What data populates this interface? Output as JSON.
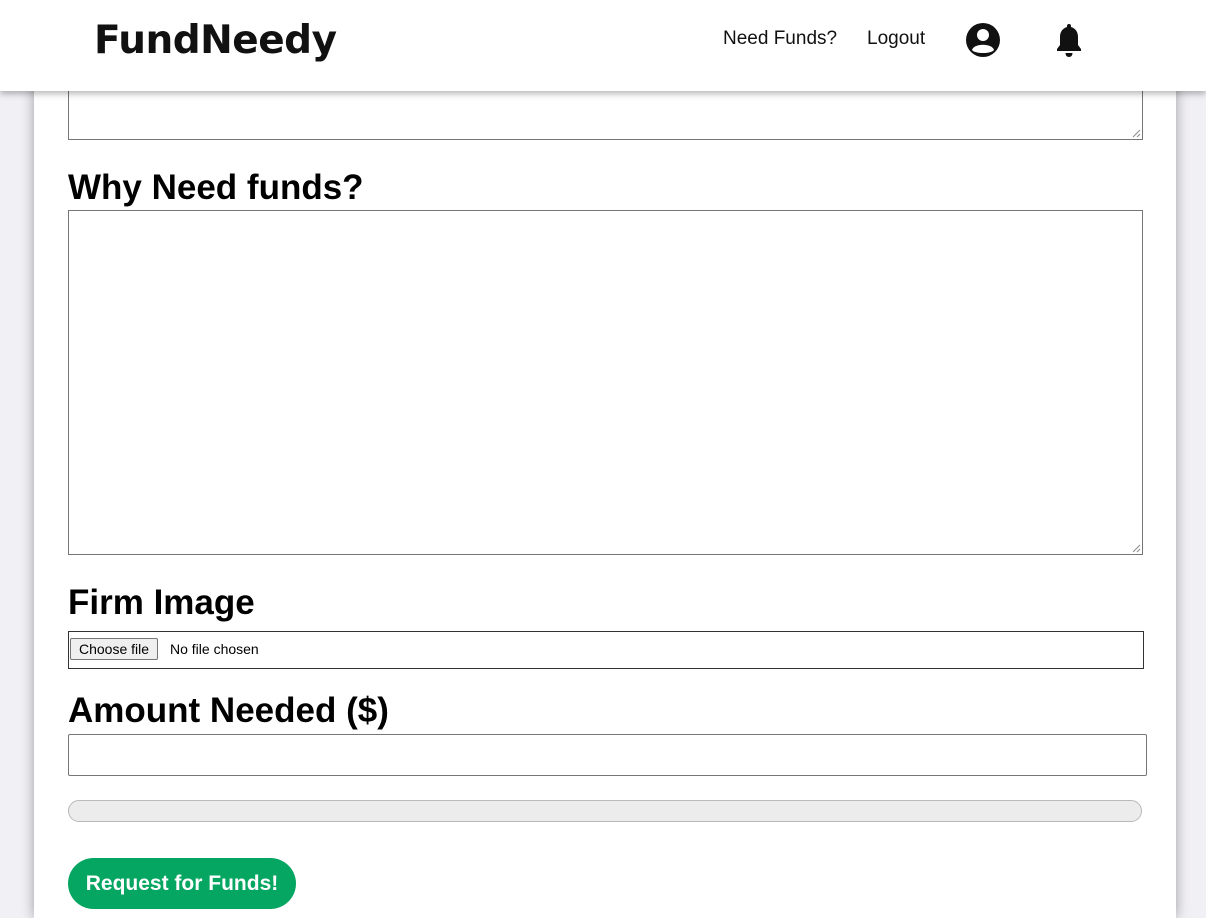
{
  "navbar": {
    "brand": "FundNeedy",
    "links": [
      "Need Funds?",
      "Logout"
    ],
    "icons": [
      "user-circle-icon",
      "bell-icon"
    ]
  },
  "form": {
    "why_label": "Why Need funds?",
    "image_label": "Firm Image",
    "file_button": "Choose file",
    "file_status": "No file chosen",
    "amount_label": "Amount Needed ($)",
    "amount_value": "",
    "progress_percent": 0,
    "submit_label": "Request for Funds!"
  },
  "colors": {
    "accent": "#05a661",
    "background": "#f1f0f5"
  }
}
